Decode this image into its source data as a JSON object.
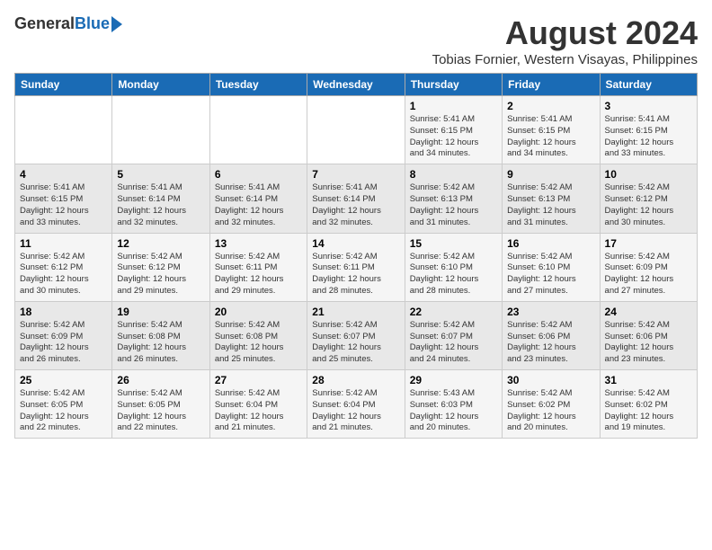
{
  "header": {
    "logo_general": "General",
    "logo_blue": "Blue",
    "title": "August 2024",
    "subtitle": "Tobias Fornier, Western Visayas, Philippines"
  },
  "weekdays": [
    "Sunday",
    "Monday",
    "Tuesday",
    "Wednesday",
    "Thursday",
    "Friday",
    "Saturday"
  ],
  "weeks": [
    [
      {
        "day": "",
        "info": ""
      },
      {
        "day": "",
        "info": ""
      },
      {
        "day": "",
        "info": ""
      },
      {
        "day": "",
        "info": ""
      },
      {
        "day": "1",
        "info": "Sunrise: 5:41 AM\nSunset: 6:15 PM\nDaylight: 12 hours\nand 34 minutes."
      },
      {
        "day": "2",
        "info": "Sunrise: 5:41 AM\nSunset: 6:15 PM\nDaylight: 12 hours\nand 34 minutes."
      },
      {
        "day": "3",
        "info": "Sunrise: 5:41 AM\nSunset: 6:15 PM\nDaylight: 12 hours\nand 33 minutes."
      }
    ],
    [
      {
        "day": "4",
        "info": "Sunrise: 5:41 AM\nSunset: 6:15 PM\nDaylight: 12 hours\nand 33 minutes."
      },
      {
        "day": "5",
        "info": "Sunrise: 5:41 AM\nSunset: 6:14 PM\nDaylight: 12 hours\nand 32 minutes."
      },
      {
        "day": "6",
        "info": "Sunrise: 5:41 AM\nSunset: 6:14 PM\nDaylight: 12 hours\nand 32 minutes."
      },
      {
        "day": "7",
        "info": "Sunrise: 5:41 AM\nSunset: 6:14 PM\nDaylight: 12 hours\nand 32 minutes."
      },
      {
        "day": "8",
        "info": "Sunrise: 5:42 AM\nSunset: 6:13 PM\nDaylight: 12 hours\nand 31 minutes."
      },
      {
        "day": "9",
        "info": "Sunrise: 5:42 AM\nSunset: 6:13 PM\nDaylight: 12 hours\nand 31 minutes."
      },
      {
        "day": "10",
        "info": "Sunrise: 5:42 AM\nSunset: 6:12 PM\nDaylight: 12 hours\nand 30 minutes."
      }
    ],
    [
      {
        "day": "11",
        "info": "Sunrise: 5:42 AM\nSunset: 6:12 PM\nDaylight: 12 hours\nand 30 minutes."
      },
      {
        "day": "12",
        "info": "Sunrise: 5:42 AM\nSunset: 6:12 PM\nDaylight: 12 hours\nand 29 minutes."
      },
      {
        "day": "13",
        "info": "Sunrise: 5:42 AM\nSunset: 6:11 PM\nDaylight: 12 hours\nand 29 minutes."
      },
      {
        "day": "14",
        "info": "Sunrise: 5:42 AM\nSunset: 6:11 PM\nDaylight: 12 hours\nand 28 minutes."
      },
      {
        "day": "15",
        "info": "Sunrise: 5:42 AM\nSunset: 6:10 PM\nDaylight: 12 hours\nand 28 minutes."
      },
      {
        "day": "16",
        "info": "Sunrise: 5:42 AM\nSunset: 6:10 PM\nDaylight: 12 hours\nand 27 minutes."
      },
      {
        "day": "17",
        "info": "Sunrise: 5:42 AM\nSunset: 6:09 PM\nDaylight: 12 hours\nand 27 minutes."
      }
    ],
    [
      {
        "day": "18",
        "info": "Sunrise: 5:42 AM\nSunset: 6:09 PM\nDaylight: 12 hours\nand 26 minutes."
      },
      {
        "day": "19",
        "info": "Sunrise: 5:42 AM\nSunset: 6:08 PM\nDaylight: 12 hours\nand 26 minutes."
      },
      {
        "day": "20",
        "info": "Sunrise: 5:42 AM\nSunset: 6:08 PM\nDaylight: 12 hours\nand 25 minutes."
      },
      {
        "day": "21",
        "info": "Sunrise: 5:42 AM\nSunset: 6:07 PM\nDaylight: 12 hours\nand 25 minutes."
      },
      {
        "day": "22",
        "info": "Sunrise: 5:42 AM\nSunset: 6:07 PM\nDaylight: 12 hours\nand 24 minutes."
      },
      {
        "day": "23",
        "info": "Sunrise: 5:42 AM\nSunset: 6:06 PM\nDaylight: 12 hours\nand 23 minutes."
      },
      {
        "day": "24",
        "info": "Sunrise: 5:42 AM\nSunset: 6:06 PM\nDaylight: 12 hours\nand 23 minutes."
      }
    ],
    [
      {
        "day": "25",
        "info": "Sunrise: 5:42 AM\nSunset: 6:05 PM\nDaylight: 12 hours\nand 22 minutes."
      },
      {
        "day": "26",
        "info": "Sunrise: 5:42 AM\nSunset: 6:05 PM\nDaylight: 12 hours\nand 22 minutes."
      },
      {
        "day": "27",
        "info": "Sunrise: 5:42 AM\nSunset: 6:04 PM\nDaylight: 12 hours\nand 21 minutes."
      },
      {
        "day": "28",
        "info": "Sunrise: 5:42 AM\nSunset: 6:04 PM\nDaylight: 12 hours\nand 21 minutes."
      },
      {
        "day": "29",
        "info": "Sunrise: 5:43 AM\nSunset: 6:03 PM\nDaylight: 12 hours\nand 20 minutes."
      },
      {
        "day": "30",
        "info": "Sunrise: 5:42 AM\nSunset: 6:02 PM\nDaylight: 12 hours\nand 20 minutes."
      },
      {
        "day": "31",
        "info": "Sunrise: 5:42 AM\nSunset: 6:02 PM\nDaylight: 12 hours\nand 19 minutes."
      }
    ]
  ]
}
